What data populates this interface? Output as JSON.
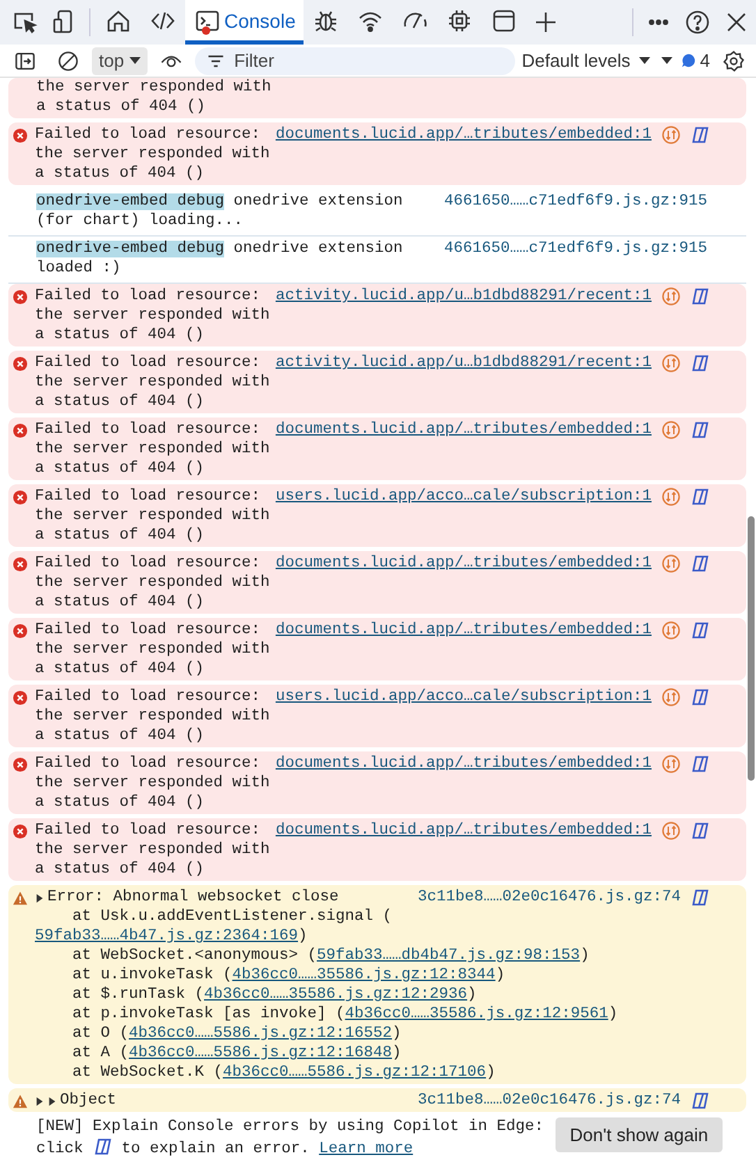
{
  "toolbar": {
    "tabs": [
      {
        "kind": "welcome",
        "selected": false,
        "error_dot": false
      },
      {
        "kind": "elements",
        "selected": false,
        "error_dot": false
      },
      {
        "kind": "console",
        "label": "Console",
        "selected": true,
        "error_dot": true
      },
      {
        "kind": "sources",
        "selected": false,
        "error_dot": false
      },
      {
        "kind": "network",
        "selected": false,
        "error_dot": false
      },
      {
        "kind": "performance",
        "selected": false,
        "error_dot": false
      },
      {
        "kind": "memory",
        "selected": false,
        "error_dot": false
      },
      {
        "kind": "application",
        "selected": false,
        "error_dot": false
      }
    ]
  },
  "console_bar": {
    "context": "top",
    "filter_placeholder": "Filter",
    "levels": "Default levels",
    "message_count": "4"
  },
  "messages": [
    {
      "kind": "error_cut",
      "message": "the server responded with a status of 404 ()"
    },
    {
      "kind": "error",
      "message": "Failed to load resource: the server responded with a status of 404 ()",
      "source": "documents.lucid.app/…tributes/embedded:1"
    },
    {
      "kind": "log",
      "tag": "onedrive-embed debug",
      "message": "onedrive extension (for chart) loading...",
      "source": "4661650……c71edf6f9.js.gz:915"
    },
    {
      "kind": "log",
      "tag": "onedrive-embed debug",
      "message": "onedrive extension loaded :)",
      "source": "4661650……c71edf6f9.js.gz:915"
    },
    {
      "kind": "error",
      "message": "Failed to load resource: the server responded with a status of 404 ()",
      "source": "activity.lucid.app/u…b1dbd88291/recent:1"
    },
    {
      "kind": "error",
      "message": "Failed to load resource: the server responded with a status of 404 ()",
      "source": "activity.lucid.app/u…b1dbd88291/recent:1"
    },
    {
      "kind": "error",
      "message": "Failed to load resource: the server responded with a status of 404 ()",
      "source": "documents.lucid.app/…tributes/embedded:1"
    },
    {
      "kind": "error",
      "message": "Failed to load resource: the server responded with a status of 404 ()",
      "source": "users.lucid.app/acco…cale/subscription:1"
    },
    {
      "kind": "error",
      "message": "Failed to load resource: the server responded with a status of 404 ()",
      "source": "documents.lucid.app/…tributes/embedded:1"
    },
    {
      "kind": "error",
      "message": "Failed to load resource: the server responded with a status of 404 ()",
      "source": "documents.lucid.app/…tributes/embedded:1"
    },
    {
      "kind": "error",
      "message": "Failed to load resource: the server responded with a status of 404 ()",
      "source": "users.lucid.app/acco…cale/subscription:1"
    },
    {
      "kind": "error",
      "message": "Failed to load resource: the server responded with a status of 404 ()",
      "source": "documents.lucid.app/…tributes/embedded:1"
    },
    {
      "kind": "error",
      "message": "Failed to load resource: the server responded with a status of 404 ()",
      "source": "documents.lucid.app/…tributes/embedded:1"
    },
    {
      "kind": "warning",
      "title": "Error: Abnormal websocket close",
      "source": "3c11be8……02e0c16476.js.gz:74",
      "stack": [
        {
          "text": "at Usk.u.addEventListener.signal (",
          "link": "59fab33……4b47.js.gz:2364:169",
          "suffix": ")"
        },
        {
          "text": "at WebSocket.<anonymous> (",
          "link": "59fab33……db4b47.js.gz:98:153",
          "suffix": ")"
        },
        {
          "text": "at u.invokeTask (",
          "link": "4b36cc0……35586.js.gz:12:8344",
          "suffix": ")"
        },
        {
          "text": "at $.runTask (",
          "link": "4b36cc0……35586.js.gz:12:2936",
          "suffix": ")"
        },
        {
          "text": "at p.invokeTask [as invoke] (",
          "link": "4b36cc0……35586.js.gz:12:9561",
          "suffix": ")"
        },
        {
          "text": "at O (",
          "link": "4b36cc0……5586.js.gz:12:16552",
          "suffix": ")"
        },
        {
          "text": "at A (",
          "link": "4b36cc0……5586.js.gz:12:16848",
          "suffix": ")"
        },
        {
          "text": "at WebSocket.K (",
          "link": "4b36cc0……5586.js.gz:12:17106",
          "suffix": ")"
        }
      ]
    },
    {
      "kind": "object",
      "label": "Object",
      "source": "3c11be8……02e0c16476.js.gz:74"
    }
  ],
  "notice": {
    "intro": "[NEW] Explain Console errors by using Copilot in Edge:",
    "text_before": "click",
    "text_after": "to explain an error.",
    "link": "Learn more",
    "button": "Don't show again"
  }
}
